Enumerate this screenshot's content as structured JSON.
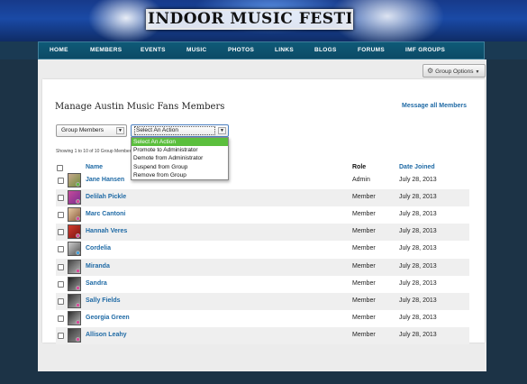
{
  "site": {
    "logo_text": "INDOOR MUSIC FESTIVALS",
    "nav": [
      "HOME",
      "MEMBERS",
      "EVENTS",
      "MUSIC",
      "PHOTOS",
      "LINKS",
      "BLOGS",
      "FORUMS",
      "IMF GROUPS"
    ]
  },
  "group_options": {
    "label": "Group Options",
    "icon": "gear-icon"
  },
  "page": {
    "title": "Manage Austin Music Fans Members",
    "message_all": "Message all Members",
    "filter_select": "Group Members",
    "action_select": "Select An Action",
    "action_options": [
      "Select An Action",
      "Promote to Administrator",
      "Demote from Administrator",
      "Suspend from Group",
      "Remove from Group"
    ],
    "showing": "Showing 1 to 10 of 10 Group Members"
  },
  "table": {
    "columns": {
      "name": "Name",
      "role": "Role",
      "date": "Date Joined"
    },
    "rows": [
      {
        "name": "Jane Hansen",
        "role": "Admin",
        "date": "July 28, 2013"
      },
      {
        "name": "Delilah Pickle",
        "role": "Member",
        "date": "July 28, 2013"
      },
      {
        "name": "Marc Cantoni",
        "role": "Member",
        "date": "July 28, 2013"
      },
      {
        "name": "Hannah Veres",
        "role": "Member",
        "date": "July 28, 2013"
      },
      {
        "name": "Cordelia",
        "role": "Member",
        "date": "July 28, 2013"
      },
      {
        "name": "Miranda",
        "role": "Member",
        "date": "July 28, 2013"
      },
      {
        "name": "Sandra",
        "role": "Member",
        "date": "July 28, 2013"
      },
      {
        "name": "Sally Fields",
        "role": "Member",
        "date": "July 28, 2013"
      },
      {
        "name": "Georgia Green",
        "role": "Member",
        "date": "July 28, 2013"
      },
      {
        "name": "Allison Leahy",
        "role": "Member",
        "date": "July 28, 2013"
      }
    ]
  },
  "colors": {
    "link": "#1f6aa5",
    "nav_bg": "#0c4a66",
    "selected_option": "#5bbf3d",
    "page_bg": "#1c3346"
  }
}
